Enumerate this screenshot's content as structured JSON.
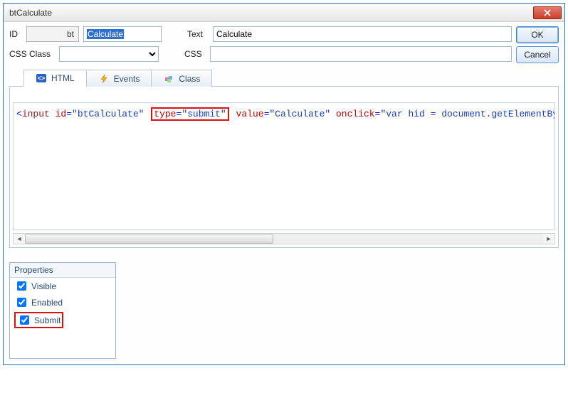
{
  "title": "btCalculate",
  "labels": {
    "id": "ID",
    "text": "Text",
    "cssclass": "CSS Class",
    "css": "CSS"
  },
  "fields": {
    "id_prefix": "bt",
    "id_value": "Calculate",
    "text_value": "Calculate",
    "cssclass_value": "",
    "css_value": ""
  },
  "buttons": {
    "ok": "OK",
    "cancel": "Cancel"
  },
  "tabs": {
    "html": "HTML",
    "events": "Events",
    "class": "Class"
  },
  "code": {
    "p1": "<",
    "p2": "input",
    "p3": " id",
    "p4": "=",
    "p5": "\"btCalculate\"",
    "h1": "type",
    "h2": "=",
    "h3": "\"submit\"",
    "p6": "value",
    "p7": "=",
    "p8": "\"Calculate\"",
    "p9": " onclick",
    "p10": "=",
    "p11": "\"var hid = document.getElementById('se"
  },
  "properties": {
    "title": "Properties",
    "visible": "Visible",
    "enabled": "Enabled",
    "submit": "Submit"
  }
}
